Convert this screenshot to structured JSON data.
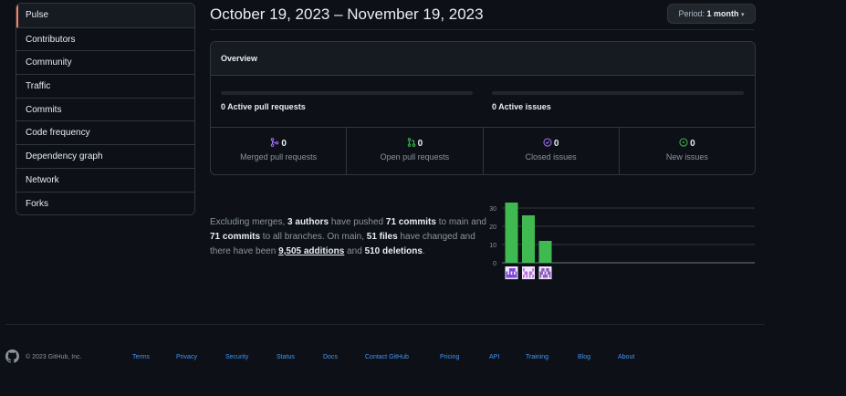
{
  "sidebar": {
    "items": [
      {
        "label": "Pulse"
      },
      {
        "label": "Contributors"
      },
      {
        "label": "Community"
      },
      {
        "label": "Traffic"
      },
      {
        "label": "Commits"
      },
      {
        "label": "Code frequency"
      },
      {
        "label": "Dependency graph"
      },
      {
        "label": "Network"
      },
      {
        "label": "Forks"
      }
    ]
  },
  "header": {
    "date_range": "October 19, 2023 – November 19, 2023",
    "period_label": "Period:",
    "period_value": "1 month"
  },
  "overview": {
    "title": "Overview",
    "active_pull_requests": "0 Active pull requests",
    "active_issues": "0 Active issues",
    "stats": [
      {
        "count": "0",
        "label": "Merged pull requests",
        "icon": "merge-icon",
        "color": "#a371f7"
      },
      {
        "count": "0",
        "label": "Open pull requests",
        "icon": "pull-request-icon",
        "color": "#3fb950"
      },
      {
        "count": "0",
        "label": "Closed issues",
        "icon": "issue-closed-icon",
        "color": "#a371f7"
      },
      {
        "count": "0",
        "label": "New issues",
        "icon": "issue-opened-icon",
        "color": "#3fb950"
      }
    ]
  },
  "summary": {
    "t1": "Excluding merges, ",
    "authors": "3 authors",
    "t2": " have pushed ",
    "commits_main": "71 commits",
    "t3": " to main and ",
    "commits_all": "71 commits",
    "t4": " to all branches. On main, ",
    "files": "51 files",
    "t5": " have changed and there have been ",
    "additions": "9,505 additions",
    "t6": " and ",
    "deletions": "510 deletions",
    "t7": "."
  },
  "chart_data": {
    "type": "bar",
    "categories": [
      "author-1",
      "author-2",
      "author-3"
    ],
    "values": [
      33,
      26,
      12
    ],
    "ylim": [
      0,
      35
    ],
    "yticks": [
      "0",
      "10",
      "20",
      "30"
    ],
    "bar_color": "#3fb950"
  },
  "footer": {
    "copyright": "© 2023 GitHub, Inc.",
    "links": [
      "Terms",
      "Privacy",
      "Security",
      "Status",
      "Docs",
      "Contact GitHub",
      "Pricing",
      "API",
      "Training",
      "Blog",
      "About"
    ]
  }
}
